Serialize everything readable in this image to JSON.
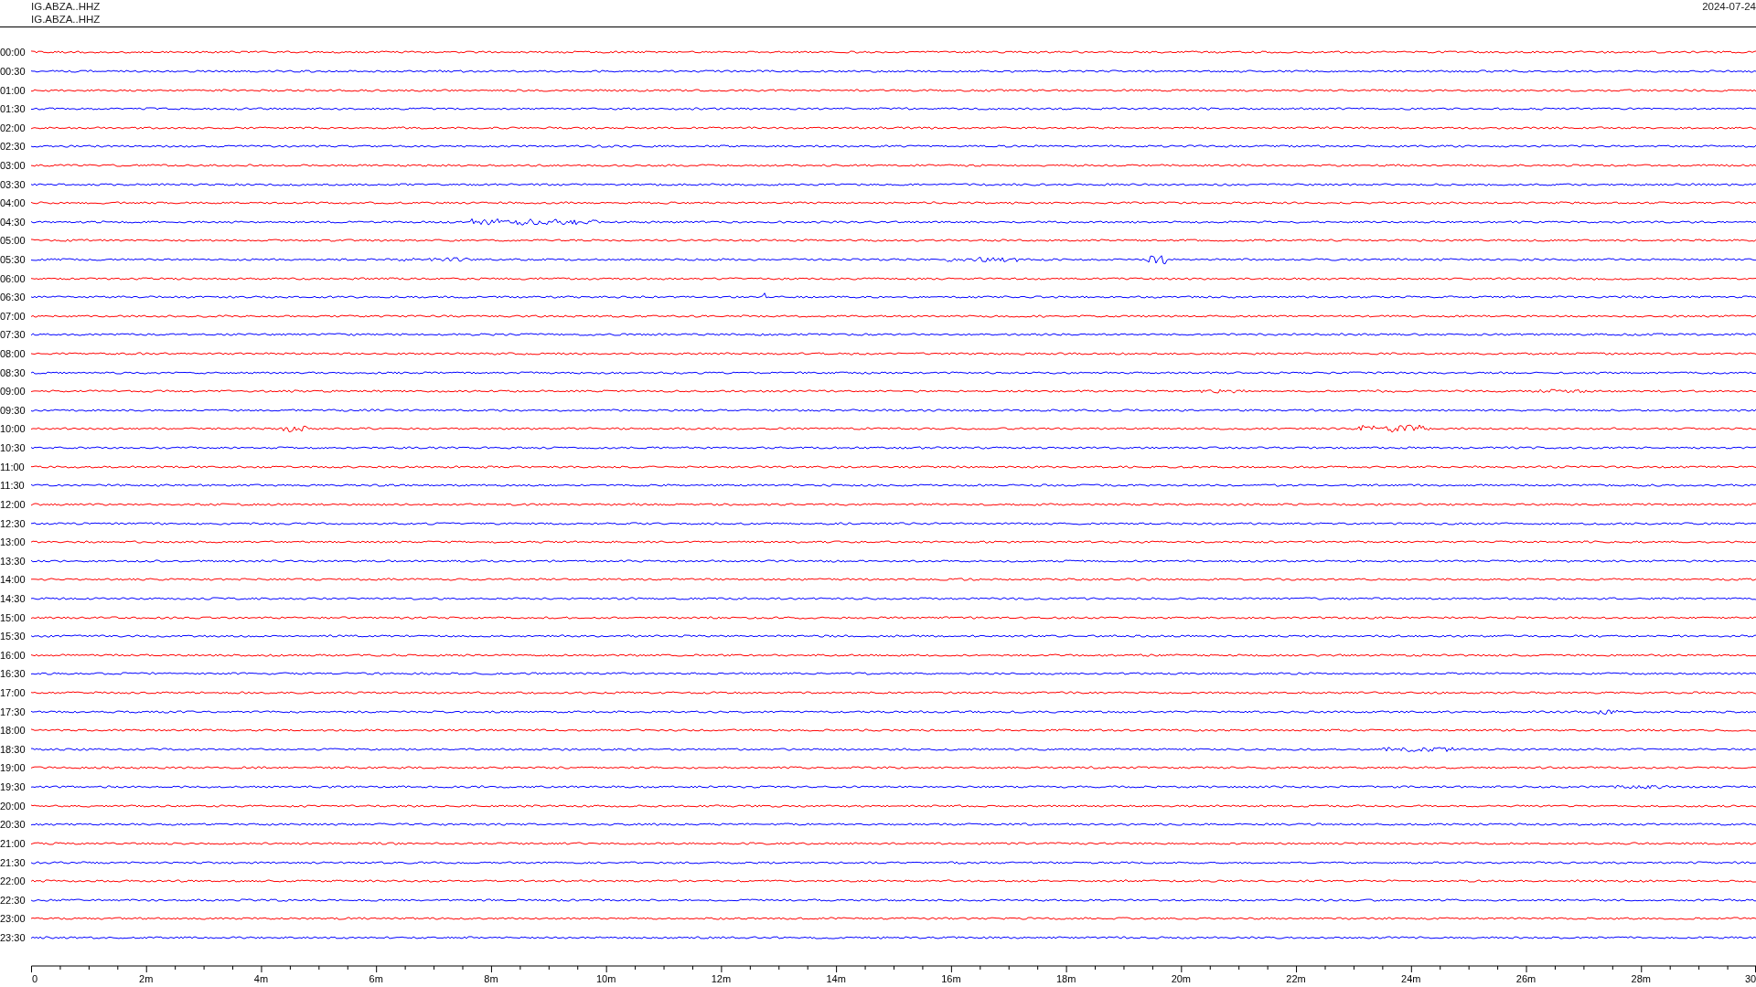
{
  "header": {
    "station_lines": [
      "IG.ABZA..HHZ",
      "IG.ABZA..HHZ"
    ],
    "date": "2024-07-24"
  },
  "traces": [
    {
      "label": "00:00",
      "color": "#ff0000"
    },
    {
      "label": "00:30",
      "color": "#0000ff"
    },
    {
      "label": "01:00",
      "color": "#ff0000"
    },
    {
      "label": "01:30",
      "color": "#0000ff"
    },
    {
      "label": "02:00",
      "color": "#ff0000"
    },
    {
      "label": "02:30",
      "color": "#0000ff"
    },
    {
      "label": "03:00",
      "color": "#ff0000"
    },
    {
      "label": "03:30",
      "color": "#0000ff"
    },
    {
      "label": "04:00",
      "color": "#ff0000"
    },
    {
      "label": "04:30",
      "color": "#0000ff"
    },
    {
      "label": "05:00",
      "color": "#ff0000"
    },
    {
      "label": "05:30",
      "color": "#0000ff"
    },
    {
      "label": "06:00",
      "color": "#ff0000"
    },
    {
      "label": "06:30",
      "color": "#0000ff"
    },
    {
      "label": "07:00",
      "color": "#ff0000"
    },
    {
      "label": "07:30",
      "color": "#0000ff"
    },
    {
      "label": "08:00",
      "color": "#ff0000"
    },
    {
      "label": "08:30",
      "color": "#0000ff"
    },
    {
      "label": "09:00",
      "color": "#ff0000"
    },
    {
      "label": "09:30",
      "color": "#0000ff"
    },
    {
      "label": "10:00",
      "color": "#ff0000"
    },
    {
      "label": "10:30",
      "color": "#0000ff"
    },
    {
      "label": "11:00",
      "color": "#ff0000"
    },
    {
      "label": "11:30",
      "color": "#0000ff"
    },
    {
      "label": "12:00",
      "color": "#ff0000"
    },
    {
      "label": "12:30",
      "color": "#0000ff"
    },
    {
      "label": "13:00",
      "color": "#ff0000"
    },
    {
      "label": "13:30",
      "color": "#0000ff"
    },
    {
      "label": "14:00",
      "color": "#ff0000"
    },
    {
      "label": "14:30",
      "color": "#0000ff"
    },
    {
      "label": "15:00",
      "color": "#ff0000"
    },
    {
      "label": "15:30",
      "color": "#0000ff"
    },
    {
      "label": "16:00",
      "color": "#ff0000"
    },
    {
      "label": "16:30",
      "color": "#0000ff"
    },
    {
      "label": "17:00",
      "color": "#ff0000"
    },
    {
      "label": "17:30",
      "color": "#0000ff"
    },
    {
      "label": "18:00",
      "color": "#ff0000"
    },
    {
      "label": "18:30",
      "color": "#0000ff"
    },
    {
      "label": "19:00",
      "color": "#ff0000"
    },
    {
      "label": "19:30",
      "color": "#0000ff"
    },
    {
      "label": "20:00",
      "color": "#ff0000"
    },
    {
      "label": "20:30",
      "color": "#0000ff"
    },
    {
      "label": "21:00",
      "color": "#ff0000"
    },
    {
      "label": "21:30",
      "color": "#0000ff"
    },
    {
      "label": "22:00",
      "color": "#ff0000"
    },
    {
      "label": "22:30",
      "color": "#0000ff"
    },
    {
      "label": "23:00",
      "color": "#ff0000"
    },
    {
      "label": "23:30",
      "color": "#0000ff"
    }
  ],
  "axis": {
    "labels": [
      "0",
      "2m",
      "4m",
      "6m",
      "8m",
      "10m",
      "12m",
      "14m",
      "16m",
      "18m",
      "20m",
      "22m",
      "24m",
      "26m",
      "28m",
      "30"
    ]
  }
}
